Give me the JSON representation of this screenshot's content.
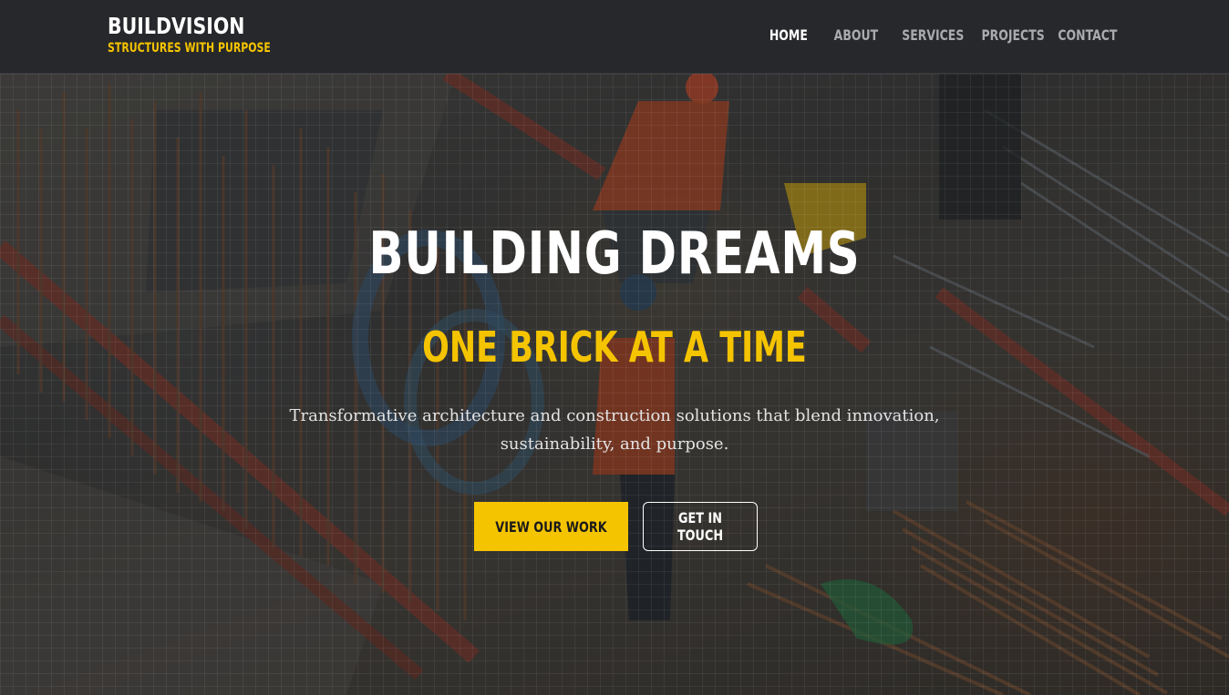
{
  "header": {
    "brand_name": "BUILDVISION",
    "brand_tagline": "STRUCTURES WITH PURPOSE",
    "nav": [
      {
        "label": "HOME",
        "active": true
      },
      {
        "label": "ABOUT",
        "active": false
      },
      {
        "label": "SERVICES",
        "active": false
      },
      {
        "label": "PROJECTS",
        "active": false
      },
      {
        "label": "CONTACT",
        "active": false
      }
    ]
  },
  "hero": {
    "title": "BUILDING DREAMS",
    "subtitle": "ONE BRICK AT A TIME",
    "description": "Transformative architecture and construction solutions that blend innovation, sustainability, and purpose.",
    "primary_button": "VIEW OUR WORK",
    "secondary_button": "GET IN TOUCH"
  },
  "colors": {
    "accent": "#f5c400",
    "header_bg": "#27282b",
    "nav_active": "#ffffff",
    "nav_inactive": "#a9abae"
  }
}
